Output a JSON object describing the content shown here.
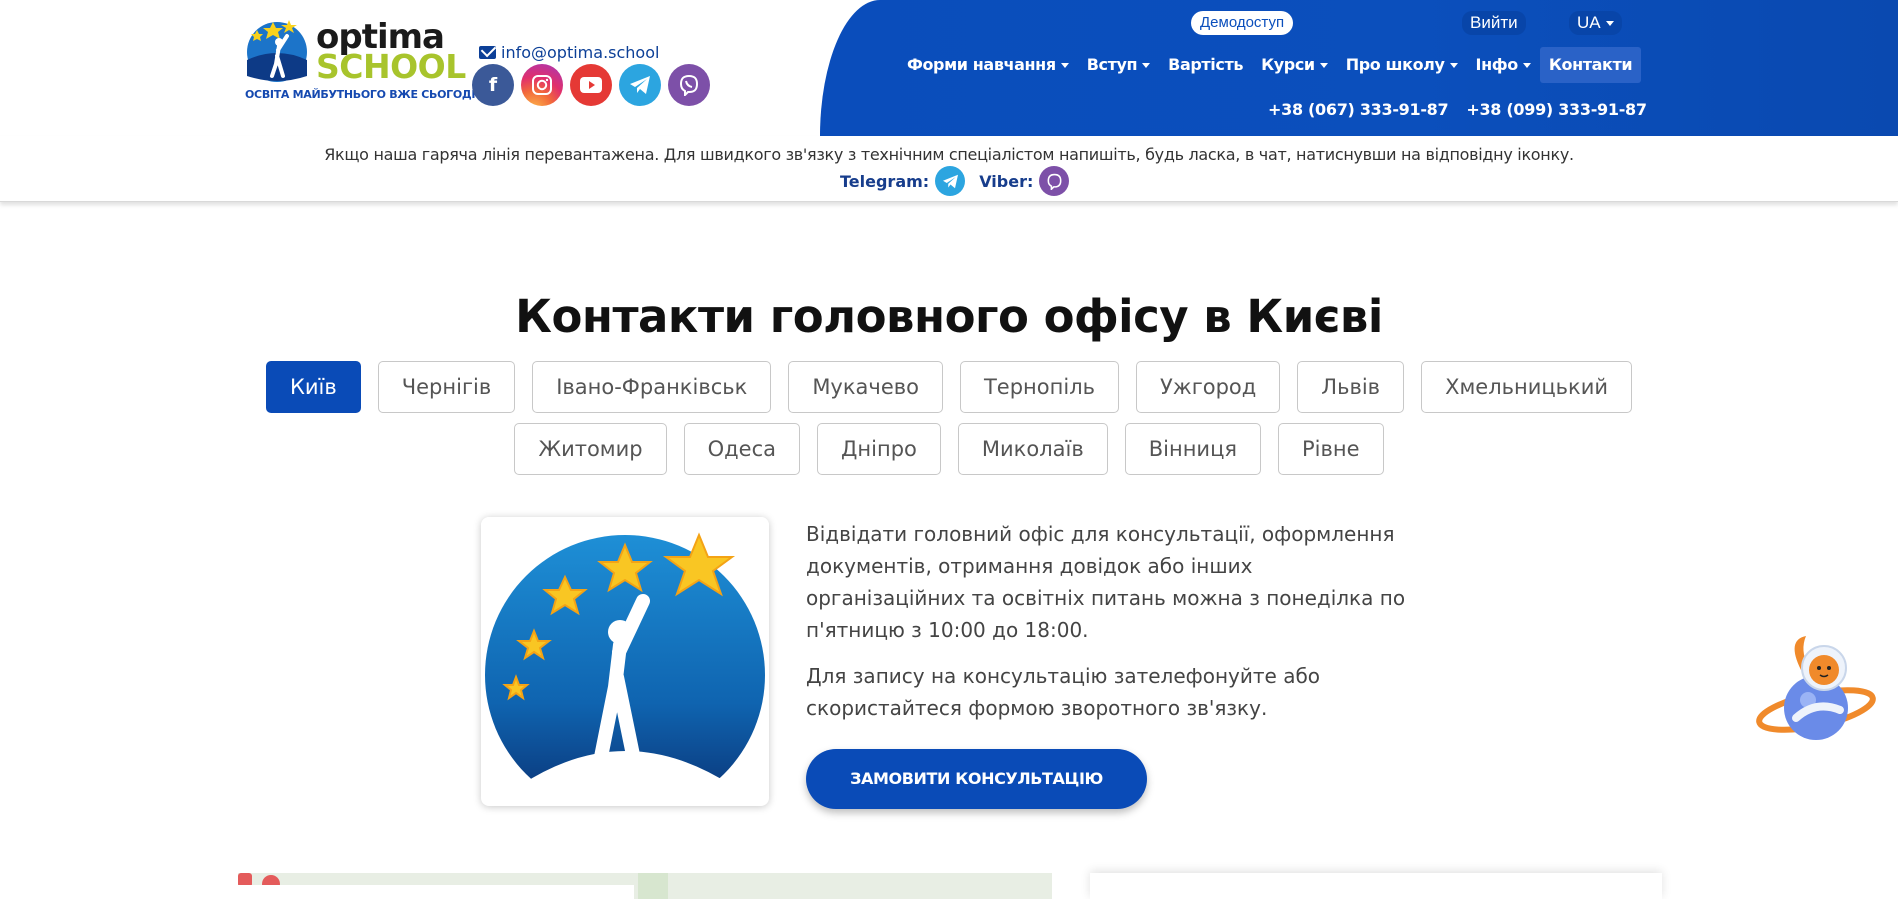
{
  "header": {
    "logo": {
      "word_top": "optima",
      "word_bottom": "SCHOOL",
      "slogan": "ОСВІТА МАЙБУТНЬОГО ВЖЕ СЬОГОДНІ"
    },
    "email": "info@optima.school",
    "socials": [
      {
        "icon": "facebook-icon",
        "glyph": "f",
        "color": "#3b5998"
      },
      {
        "icon": "instagram-icon",
        "glyph": "◎",
        "color": "#e1306c"
      },
      {
        "icon": "youtube-icon",
        "glyph": "▶",
        "color": "#e53935"
      },
      {
        "icon": "telegram-icon",
        "glyph": "➤",
        "color": "#2ca5e0"
      },
      {
        "icon": "viber-icon",
        "glyph": "✆",
        "color": "#7d50a8"
      }
    ],
    "demo_label": "Демодоступ",
    "login_label": "Вийти",
    "lang_label": "UA",
    "nav": [
      {
        "label": "Форми навчання",
        "dropdown": true
      },
      {
        "label": "Вступ",
        "dropdown": true
      },
      {
        "label": "Вартість",
        "dropdown": false
      },
      {
        "label": "Курси",
        "dropdown": true
      },
      {
        "label": "Про школу",
        "dropdown": true
      },
      {
        "label": "Інфо",
        "dropdown": true
      },
      {
        "label": "Контакти",
        "dropdown": false,
        "active": true
      }
    ],
    "phones": [
      "+38 (067) 333-91-87",
      "+38 (099) 333-91-87"
    ]
  },
  "notice": {
    "text": "Якщо наша гаряча лінія перевантажена. Для швидкого зв'язку з технічним спеціалістом напишіть, будь ласка, в чат, натиснувши на відповідну іконку.",
    "telegram_label": "Telegram:",
    "viber_label": "Viber:"
  },
  "main": {
    "title": "Контакти головного офісу в Києві",
    "cities_row1": [
      "Київ",
      "Чернігів",
      "Івано-Франківськ",
      "Мукачево",
      "Тернопіль",
      "Ужгород",
      "Львів",
      "Хмельницький"
    ],
    "cities_row2": [
      "Житомир",
      "Одеса",
      "Дніпро",
      "Миколаїв",
      "Вінниця",
      "Рівне"
    ],
    "active_city": "Київ",
    "paragraph1": "Відвідати головний офіс для консультації, оформлення документів, отримання довідок або інших організаційних та освітніх питань можна з понеділка по п'ятницю з 10:00 до 18:00.",
    "paragraph2": "Для запису на консультацію зателефонуйте або скористайтеся формою зворотного зв'язку.",
    "order_button": "ЗАМОВИТИ КОНСУЛЬТАЦІЮ"
  },
  "colors": {
    "brand_blue": "#0a4bb7",
    "logo_green": "#a8c42c"
  }
}
